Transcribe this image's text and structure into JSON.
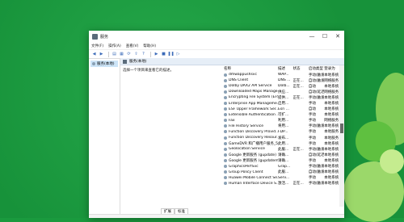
{
  "window": {
    "title": "服务",
    "menu": [
      "文件(F)",
      "操作(A)",
      "查看(V)",
      "帮助(H)"
    ],
    "controls": {
      "minimize": "—",
      "maximize": "☐",
      "close": "✕"
    }
  },
  "tree": {
    "selected": "服务(本地)"
  },
  "header": {
    "title": "服务(本地)"
  },
  "description": "选择一个项目来查看它的描述。",
  "columns": [
    "名称",
    "描述",
    "状态",
    "启动类型",
    "登录为"
  ],
  "services": [
    [
      "dmwappushsvc",
      "WAP...",
      "",
      "手动(触发...",
      "本地系统"
    ],
    [
      "DNS Client",
      "DNS ...",
      "正在...",
      "自动(触发...",
      "网络服务"
    ],
    [
      "Dolby DAX2 API Service",
      "Dolb...",
      "正在...",
      "自动",
      "本地系统"
    ],
    [
      "Downloaded Maps Manager",
      "供应...",
      "",
      "自动(延迟...",
      "网络服务"
    ],
    [
      "Encrypting File System (EFS)",
      "提供...",
      "正在...",
      "手动(触发...",
      "本地系统"
    ],
    [
      "Enterprise App Manageme...",
      "启用...",
      "",
      "手动",
      "本地系统"
    ],
    [
      "ESF Upper Framework Ser...",
      "Esri ...",
      "",
      "自动",
      "本地系统"
    ],
    [
      "Extensible Authentication ...",
      "可扩...",
      "",
      "手动",
      "本地系统"
    ],
    [
      "Fax",
      "利用...",
      "",
      "手动",
      "网络服务"
    ],
    [
      "File History Service",
      "将用...",
      "",
      "手动(触发...",
      "本地系统"
    ],
    [
      "Function Discovery Provid...",
      "FDP...",
      "",
      "手动",
      "本地服务"
    ],
    [
      "Function Discovery Resour...",
      "发布...",
      "",
      "手动",
      "本地服务"
    ],
    [
      "GameDVR 和广播用户服务_58...",
      "此用...",
      "",
      "手动",
      "本地系统"
    ],
    [
      "Geolocation Service",
      "此服...",
      "正在...",
      "手动(触发...",
      "本地系统"
    ],
    [
      "Google 更新服务 (gupdate)",
      "请确...",
      "",
      "自动(延迟...",
      "本地系统"
    ],
    [
      "Google 更新服务 (gupdatem)",
      "请确...",
      "",
      "手动",
      "本地系统"
    ],
    [
      "GraphicsPerfSvc",
      "Grap...",
      "",
      "手动(触发...",
      "本地系统"
    ],
    [
      "Group Policy Client",
      "此服...",
      "",
      "自动(触发...",
      "本地系统"
    ],
    [
      "Huawei Mobile Connect Se...",
      "Serv...",
      "",
      "手动",
      "本地系统"
    ],
    [
      "Human Interface Device S...",
      "激活...",
      "正在...",
      "手动(触发...",
      "本地系统"
    ]
  ],
  "tabs": [
    "扩展",
    "标准"
  ],
  "colors": {
    "background": "#1a9a3e",
    "selection": "#cce4f7"
  }
}
